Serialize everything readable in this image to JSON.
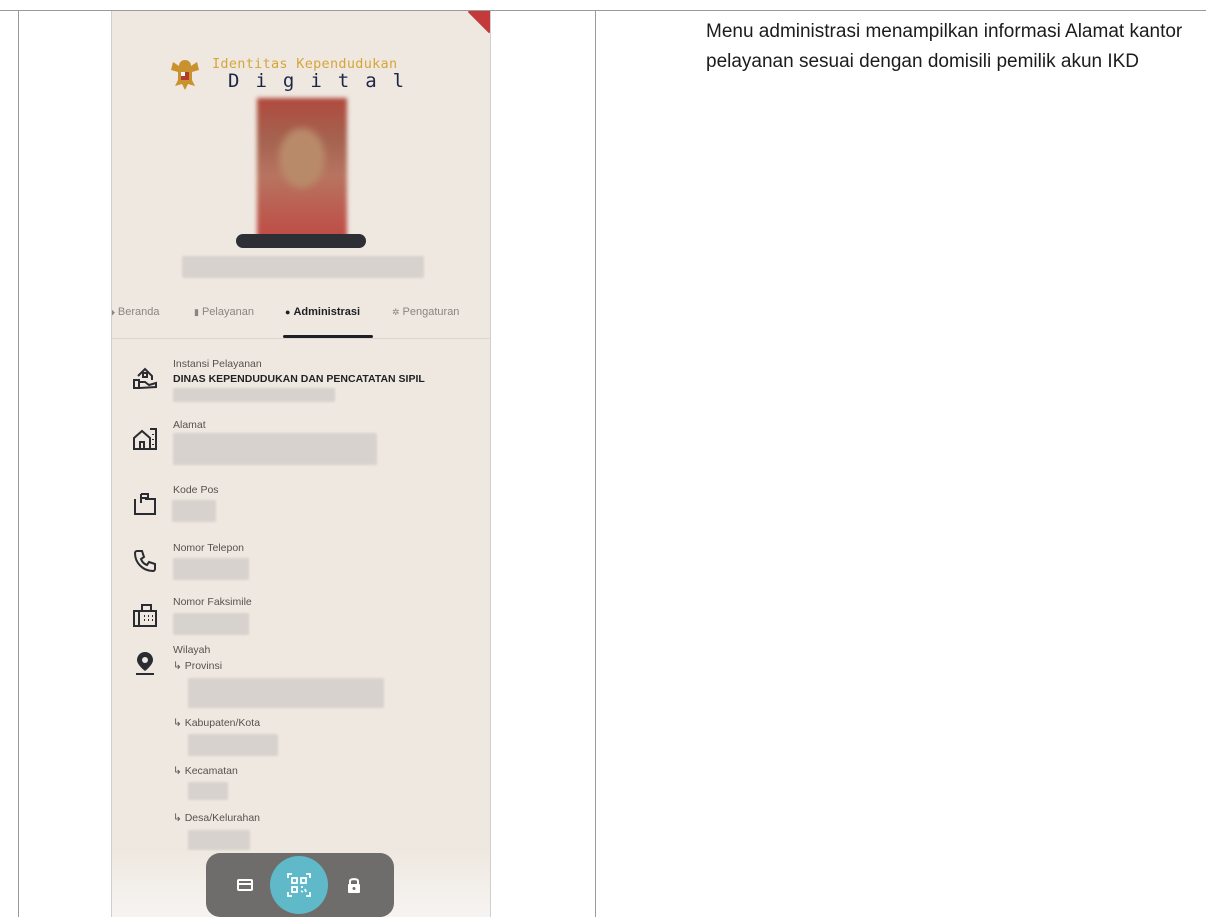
{
  "brand": {
    "line1": "Identitas Kependudukan",
    "line2": "Digital"
  },
  "tabs": [
    {
      "label": "Beranda",
      "active": false
    },
    {
      "label": "Pelayanan",
      "active": false
    },
    {
      "label": "Administrasi",
      "active": true
    },
    {
      "label": "Pengaturan",
      "active": false
    }
  ],
  "info": {
    "instansi": {
      "label": "Instansi Pelayanan",
      "value": "DINAS KEPENDUDUKAN DAN PENCATATAN SIPIL"
    },
    "alamat": {
      "label": "Alamat"
    },
    "kode_pos": {
      "label": "Kode Pos"
    },
    "telepon": {
      "label": "Nomor Telepon"
    },
    "faksimile": {
      "label": "Nomor Faksimile"
    },
    "wilayah": {
      "label": "Wilayah",
      "provinsi": "↳ Provinsi",
      "kabupaten": "↳ Kabupaten/Kota",
      "kecamatan": "↳ Kecamatan",
      "desa": "↳ Desa/Kelurahan"
    }
  },
  "bottom_nav": {
    "items": [
      "card-icon",
      "qr-scan-icon",
      "lock-icon"
    ],
    "accent": "#5fb9c8"
  },
  "caption": "Menu administrasi menampilkan informasi Alamat kantor pelayanan sesuai dengan domisili pemilik akun IKD",
  "colors": {
    "background": "#efe8e0",
    "brand_gold": "#d6a53a",
    "brand_navy": "#1f2547"
  }
}
